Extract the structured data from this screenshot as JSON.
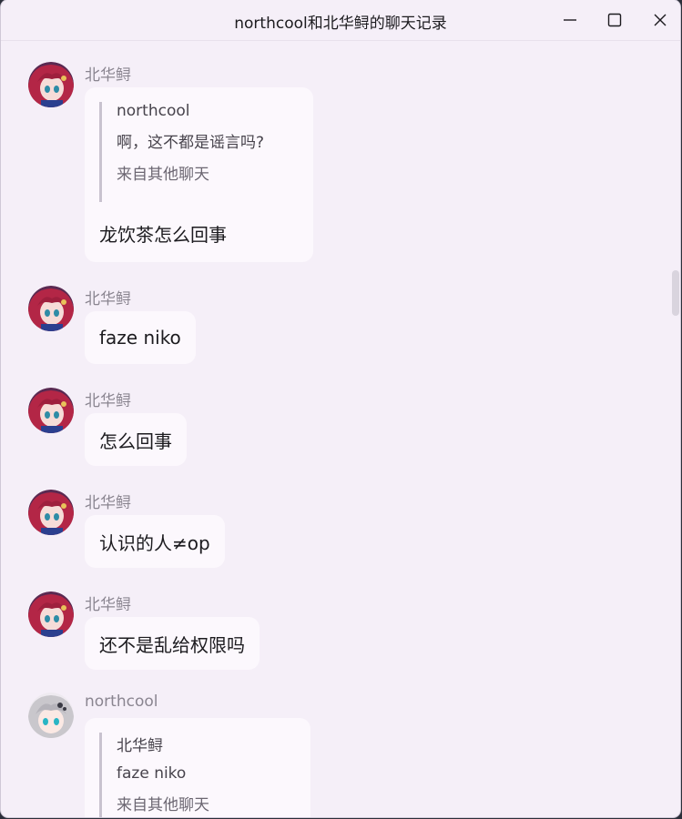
{
  "window": {
    "title": "northcool和北华鲟的聊天记录",
    "minimize_icon": "minimize-icon",
    "maximize_icon": "maximize-icon",
    "close_icon": "close-icon"
  },
  "messages": [
    {
      "sender": "北华鲟",
      "avatar": "red-hair-anime-avatar",
      "quote": {
        "sender": "northcool",
        "text": "啊，这不都是谣言吗?",
        "source": "来自其他聊天"
      },
      "text": "龙饮茶怎么回事"
    },
    {
      "sender": "北华鲟",
      "avatar": "red-hair-anime-avatar",
      "text": "faze niko"
    },
    {
      "sender": "北华鲟",
      "avatar": "red-hair-anime-avatar",
      "text": "怎么回事"
    },
    {
      "sender": "北华鲟",
      "avatar": "red-hair-anime-avatar",
      "text": "认识的人≠op"
    },
    {
      "sender": "北华鲟",
      "avatar": "red-hair-anime-avatar",
      "text": "还不是乱给权限吗"
    },
    {
      "sender": "northcool",
      "avatar": "silver-hair-anime-avatar",
      "quote": {
        "sender": "北华鲟",
        "text": "faze niko",
        "source": "来自其他聊天"
      }
    }
  ],
  "colors": {
    "background": "#f5eff8",
    "bubble": "#fcf8fd",
    "text": "#1c1b1f",
    "sender": "#8a8590"
  }
}
